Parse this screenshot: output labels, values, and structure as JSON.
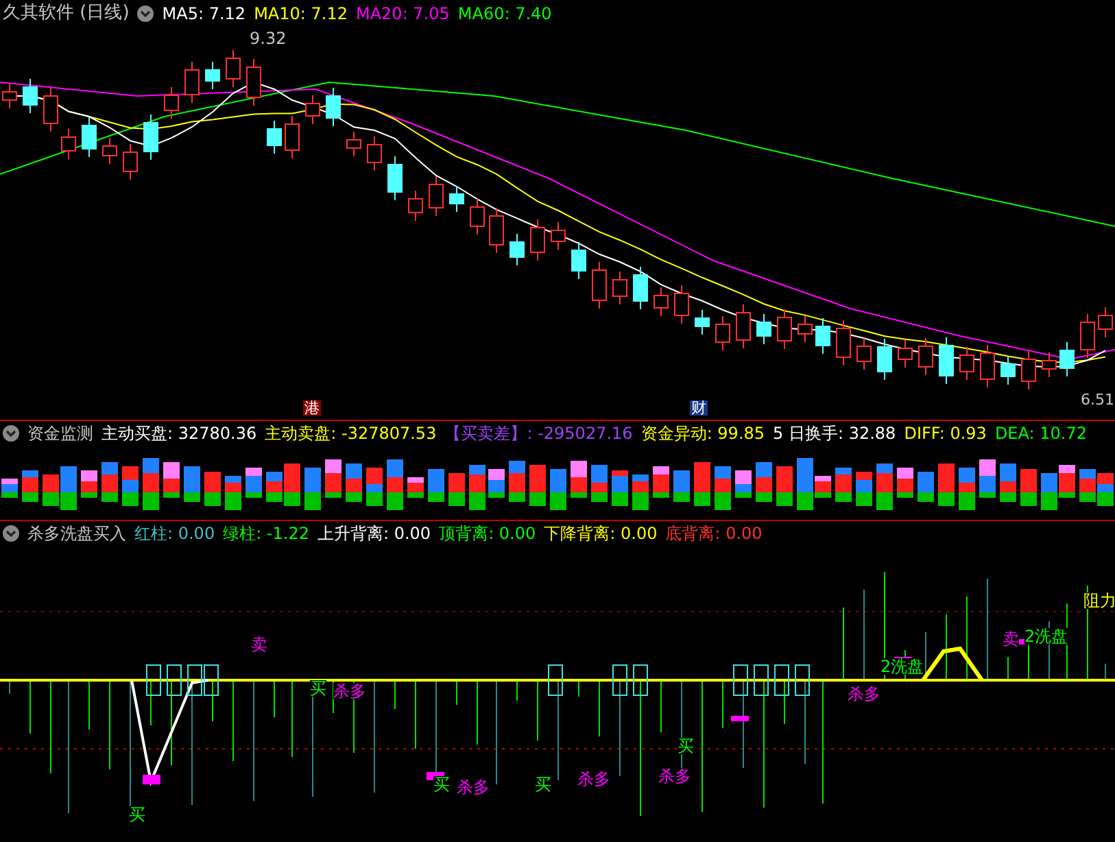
{
  "main_chart": {
    "title": "久其软件 (日线)",
    "indicators": [
      {
        "text": "MA5: 7.12",
        "color": "#ffffff"
      },
      {
        "text": "MA10: 7.12",
        "color": "#ffff00"
      },
      {
        "text": "MA20: 7.05",
        "color": "#ff00ff"
      },
      {
        "text": "MA60: 7.40",
        "color": "#00ff00"
      }
    ],
    "high_label": "9.32",
    "low_label": "6.51",
    "markers": [
      {
        "text": "港",
        "color": "#8b0000"
      },
      {
        "text": "财",
        "color": "#1a3a8a"
      }
    ]
  },
  "fund_monitor": {
    "title": "资金监测",
    "fields": [
      {
        "text": "主动买盘: 32780.36",
        "color": "#ffffff"
      },
      {
        "text": "主动卖盘: -327807.53",
        "color": "#ffff00"
      },
      {
        "text": "【买卖差】: -295027.16",
        "color": "#a040ff"
      },
      {
        "text": "资金异动: 99.85",
        "color": "#ffff00"
      },
      {
        "text": "5 日换手: 32.88",
        "color": "#ffffff"
      },
      {
        "text": "DIFF: 0.93",
        "color": "#ffff00"
      },
      {
        "text": "DEA: 10.72",
        "color": "#00ff00"
      }
    ]
  },
  "signal_panel": {
    "title": "杀多洗盘买入",
    "fields": [
      {
        "text": "红柱: 0.00",
        "color": "#40c0c0"
      },
      {
        "text": "绿柱: -1.22",
        "color": "#00ff00"
      },
      {
        "text": "上升背离: 0.00",
        "color": "#ffffff"
      },
      {
        "text": "顶背离: 0.00",
        "color": "#00ff00"
      },
      {
        "text": "下降背离: 0.00",
        "color": "#ffff00"
      },
      {
        "text": "底背离: 0.00",
        "color": "#ff3030"
      }
    ],
    "annotations": [
      {
        "text": "卖",
        "color": "#ff00ff"
      },
      {
        "text": "买",
        "color": "#00ff00"
      },
      {
        "text": "杀多",
        "color": "#ff00ff"
      },
      {
        "text": "买",
        "color": "#00ff00"
      },
      {
        "text": "买",
        "color": "#00ff00"
      },
      {
        "text": "杀多",
        "color": "#ff00ff"
      },
      {
        "text": "买",
        "color": "#00ff00"
      },
      {
        "text": "杀多",
        "color": "#ff00ff"
      },
      {
        "text": "买",
        "color": "#00ff00"
      },
      {
        "text": "杀多",
        "color": "#ff00ff"
      },
      {
        "text": "杀多",
        "color": "#ff00ff"
      },
      {
        "text": "2洗盘",
        "color": "#00ff00"
      },
      {
        "text": "卖",
        "color": "#ff00ff"
      },
      {
        "text": "2洗盘",
        "color": "#00ff00"
      },
      {
        "text": "阻力",
        "color": "#ffff00"
      }
    ]
  }
}
